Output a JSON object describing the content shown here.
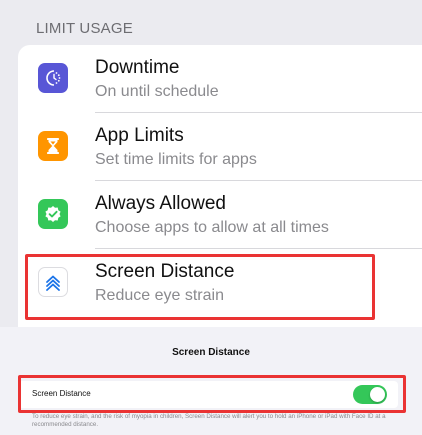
{
  "limit_usage": {
    "header": "LIMIT USAGE",
    "items": [
      {
        "title": "Downtime",
        "subtitle": "On until schedule",
        "icon": "downtime-icon",
        "color": "#5856d6"
      },
      {
        "title": "App Limits",
        "subtitle": "Set time limits for apps",
        "icon": "hourglass-icon",
        "color": "#ff9500"
      },
      {
        "title": "Always Allowed",
        "subtitle": "Choose apps to allow at all times",
        "icon": "checkmark-shield-icon",
        "color": "#34c759"
      },
      {
        "title": "Screen Distance",
        "subtitle": "Reduce eye strain",
        "icon": "screen-distance-icon",
        "color": "#1a73e8"
      }
    ]
  },
  "screen_distance_sheet": {
    "title": "Screen Distance",
    "toggle_label": "Screen Distance",
    "toggle_on": true,
    "toggle_color": "#34c759",
    "footnote": "To reduce eye strain, and the risk of myopia in children, Screen Distance will alert you to hold an iPhone or iPad with Face ID at a recommended distance."
  },
  "highlight_color": "#ea3333"
}
